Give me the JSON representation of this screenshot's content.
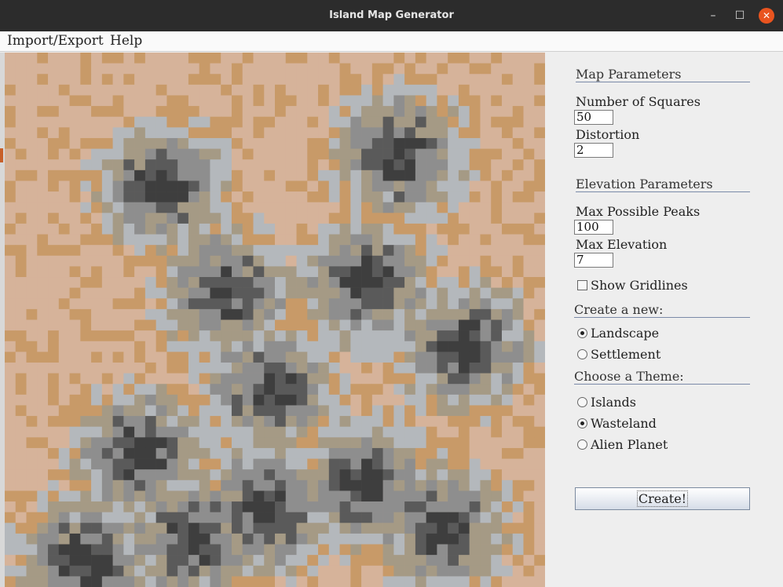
{
  "window": {
    "title": "Island Map Generator"
  },
  "window_controls": {
    "minimize": "–",
    "maximize": "☐",
    "close": "✕"
  },
  "menu": {
    "items": [
      "Import/Export",
      "Help"
    ]
  },
  "map_parameters": {
    "title": "Map Parameters",
    "num_squares_label": "Number of Squares",
    "num_squares_value": "50",
    "distortion_label": "Distortion",
    "distortion_value": "2"
  },
  "elevation_parameters": {
    "title": "Elevation Parameters",
    "max_peaks_label": "Max Possible Peaks",
    "max_peaks_value": "100",
    "max_elevation_label": "Max Elevation",
    "max_elevation_value": "7"
  },
  "gridlines": {
    "label": "Show Gridlines",
    "checked": false
  },
  "create_new": {
    "title": "Create a new:",
    "options": [
      {
        "label": "Landscape",
        "selected": true
      },
      {
        "label": "Settlement",
        "selected": false
      }
    ]
  },
  "theme": {
    "title": "Choose a Theme:",
    "options": [
      {
        "label": "Islands",
        "selected": false
      },
      {
        "label": "Wasteland",
        "selected": true
      },
      {
        "label": "Alien Planet",
        "selected": false
      }
    ]
  },
  "create_button": {
    "label": "Create!"
  },
  "map": {
    "grid_size": 50,
    "colors": {
      "sand": "#d6b39a",
      "ochre": "#c89a68",
      "light": "#b4b8bc",
      "beige": "#a59a85",
      "gray": "#8e8e8e",
      "dark": "#5a5a5a",
      "darker": "#3e3e3e"
    }
  }
}
